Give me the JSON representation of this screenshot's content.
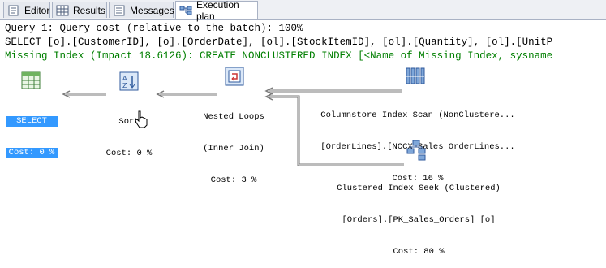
{
  "tabs": [
    {
      "label": "Editor",
      "icon": "editor-icon",
      "active": false
    },
    {
      "label": "Results",
      "icon": "grid-icon",
      "active": false
    },
    {
      "label": "Messages",
      "icon": "messages-icon",
      "active": false
    },
    {
      "label": "Execution plan",
      "icon": "execution-plan-icon",
      "active": true
    }
  ],
  "query": {
    "header": "Query 1: Query cost (relative to the batch): 100%",
    "sql": "SELECT [o].[CustomerID], [o].[OrderDate], [ol].[StockItemID], [ol].[Quantity], [ol].[UnitP",
    "missing_index": "Missing Index (Impact 18.6126): CREATE NONCLUSTERED INDEX [<Name of Missing Index, sysname"
  },
  "colors": {
    "missing_index_text": "#007f00",
    "selected_bg": "#3399ff"
  },
  "plan": {
    "select": {
      "title": "SELECT",
      "cost": "Cost: 0 %"
    },
    "sort": {
      "title": "Sort",
      "cost": "Cost: 0 %"
    },
    "nested_loops": {
      "title": "Nested Loops",
      "subtitle": "(Inner Join)",
      "cost": "Cost: 3 %"
    },
    "columnstore_scan": {
      "title": "Columnstore Index Scan (NonClustere...",
      "object": "[OrderLines].[NCCX_Sales_OrderLines...",
      "cost": "Cost: 16 %"
    },
    "index_seek": {
      "title": "Clustered Index Seek (Clustered)",
      "object": "[Orders].[PK_Sales_Orders] [o]",
      "cost": "Cost: 80 %"
    }
  }
}
